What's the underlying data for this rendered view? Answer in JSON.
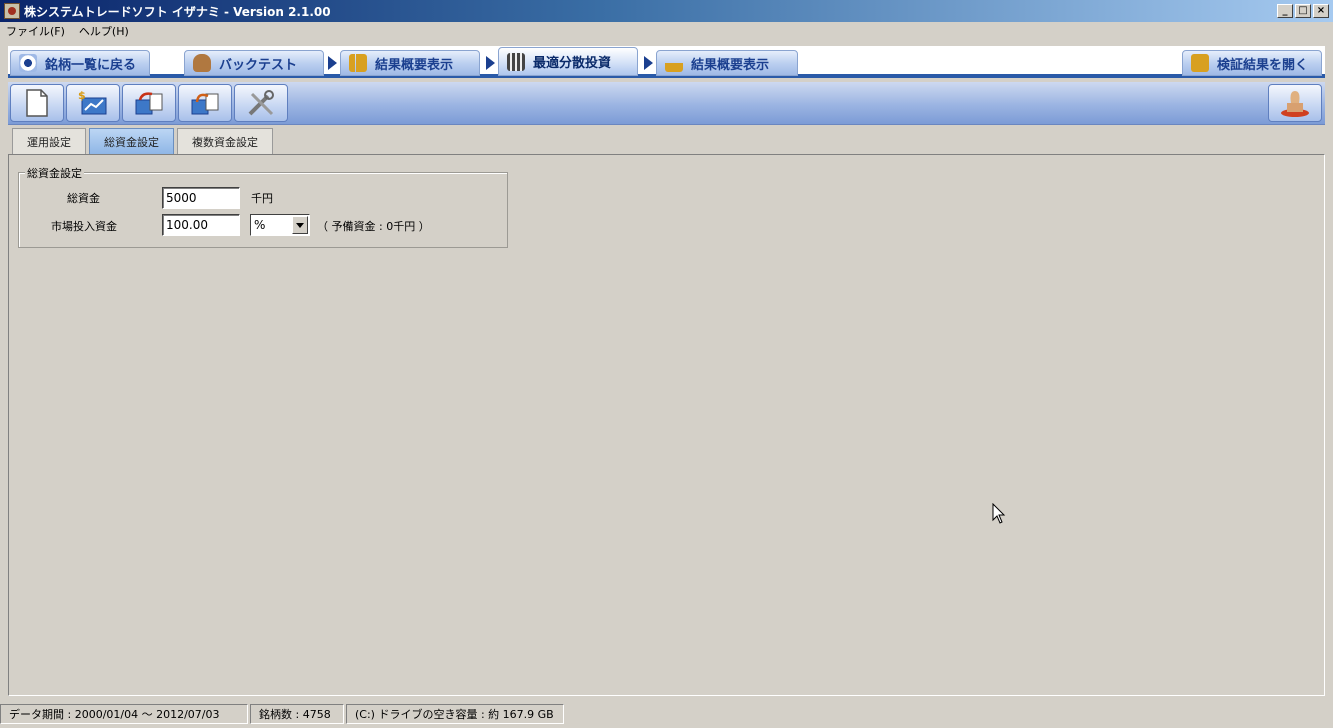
{
  "window": {
    "title": "株システムトレードソフト イザナミ - Version 2.1.00",
    "controls": [
      "_",
      "□",
      "×"
    ]
  },
  "menu": {
    "items": [
      "ファイル(F)",
      "ヘルプ(H)"
    ]
  },
  "flow_tabs": {
    "back": "銘柄一覧に戻る",
    "backtest": "バックテスト",
    "summary1": "結果概要表示",
    "optimize": "最適分散投資",
    "summary2": "結果概要表示",
    "open_results": "検証結果を開く",
    "active": "optimize"
  },
  "toolbar": {
    "buttons": [
      "new-document-icon",
      "money-chart-icon",
      "export-icon",
      "import-icon",
      "tools-icon"
    ],
    "right_button": "stamp-icon"
  },
  "settings_tabs": {
    "items": [
      "運用設定",
      "総資金設定",
      "複数資金設定"
    ],
    "active": 1
  },
  "fund_settings": {
    "group_title": "総資金設定",
    "total_label": "総資金",
    "total_value": "5000",
    "total_unit": "千円",
    "invest_label": "市場投入資金",
    "invest_value": "100.00",
    "invest_unit": "%",
    "reserve_note": "（ 予備資金 : 0千円 ）"
  },
  "status": {
    "period": "データ期間 : 2000/01/04 〜 2012/07/03",
    "count": "銘柄数 : 4758",
    "disk": "(C:) ドライブの空き容量 : 約 167.9 GB"
  }
}
